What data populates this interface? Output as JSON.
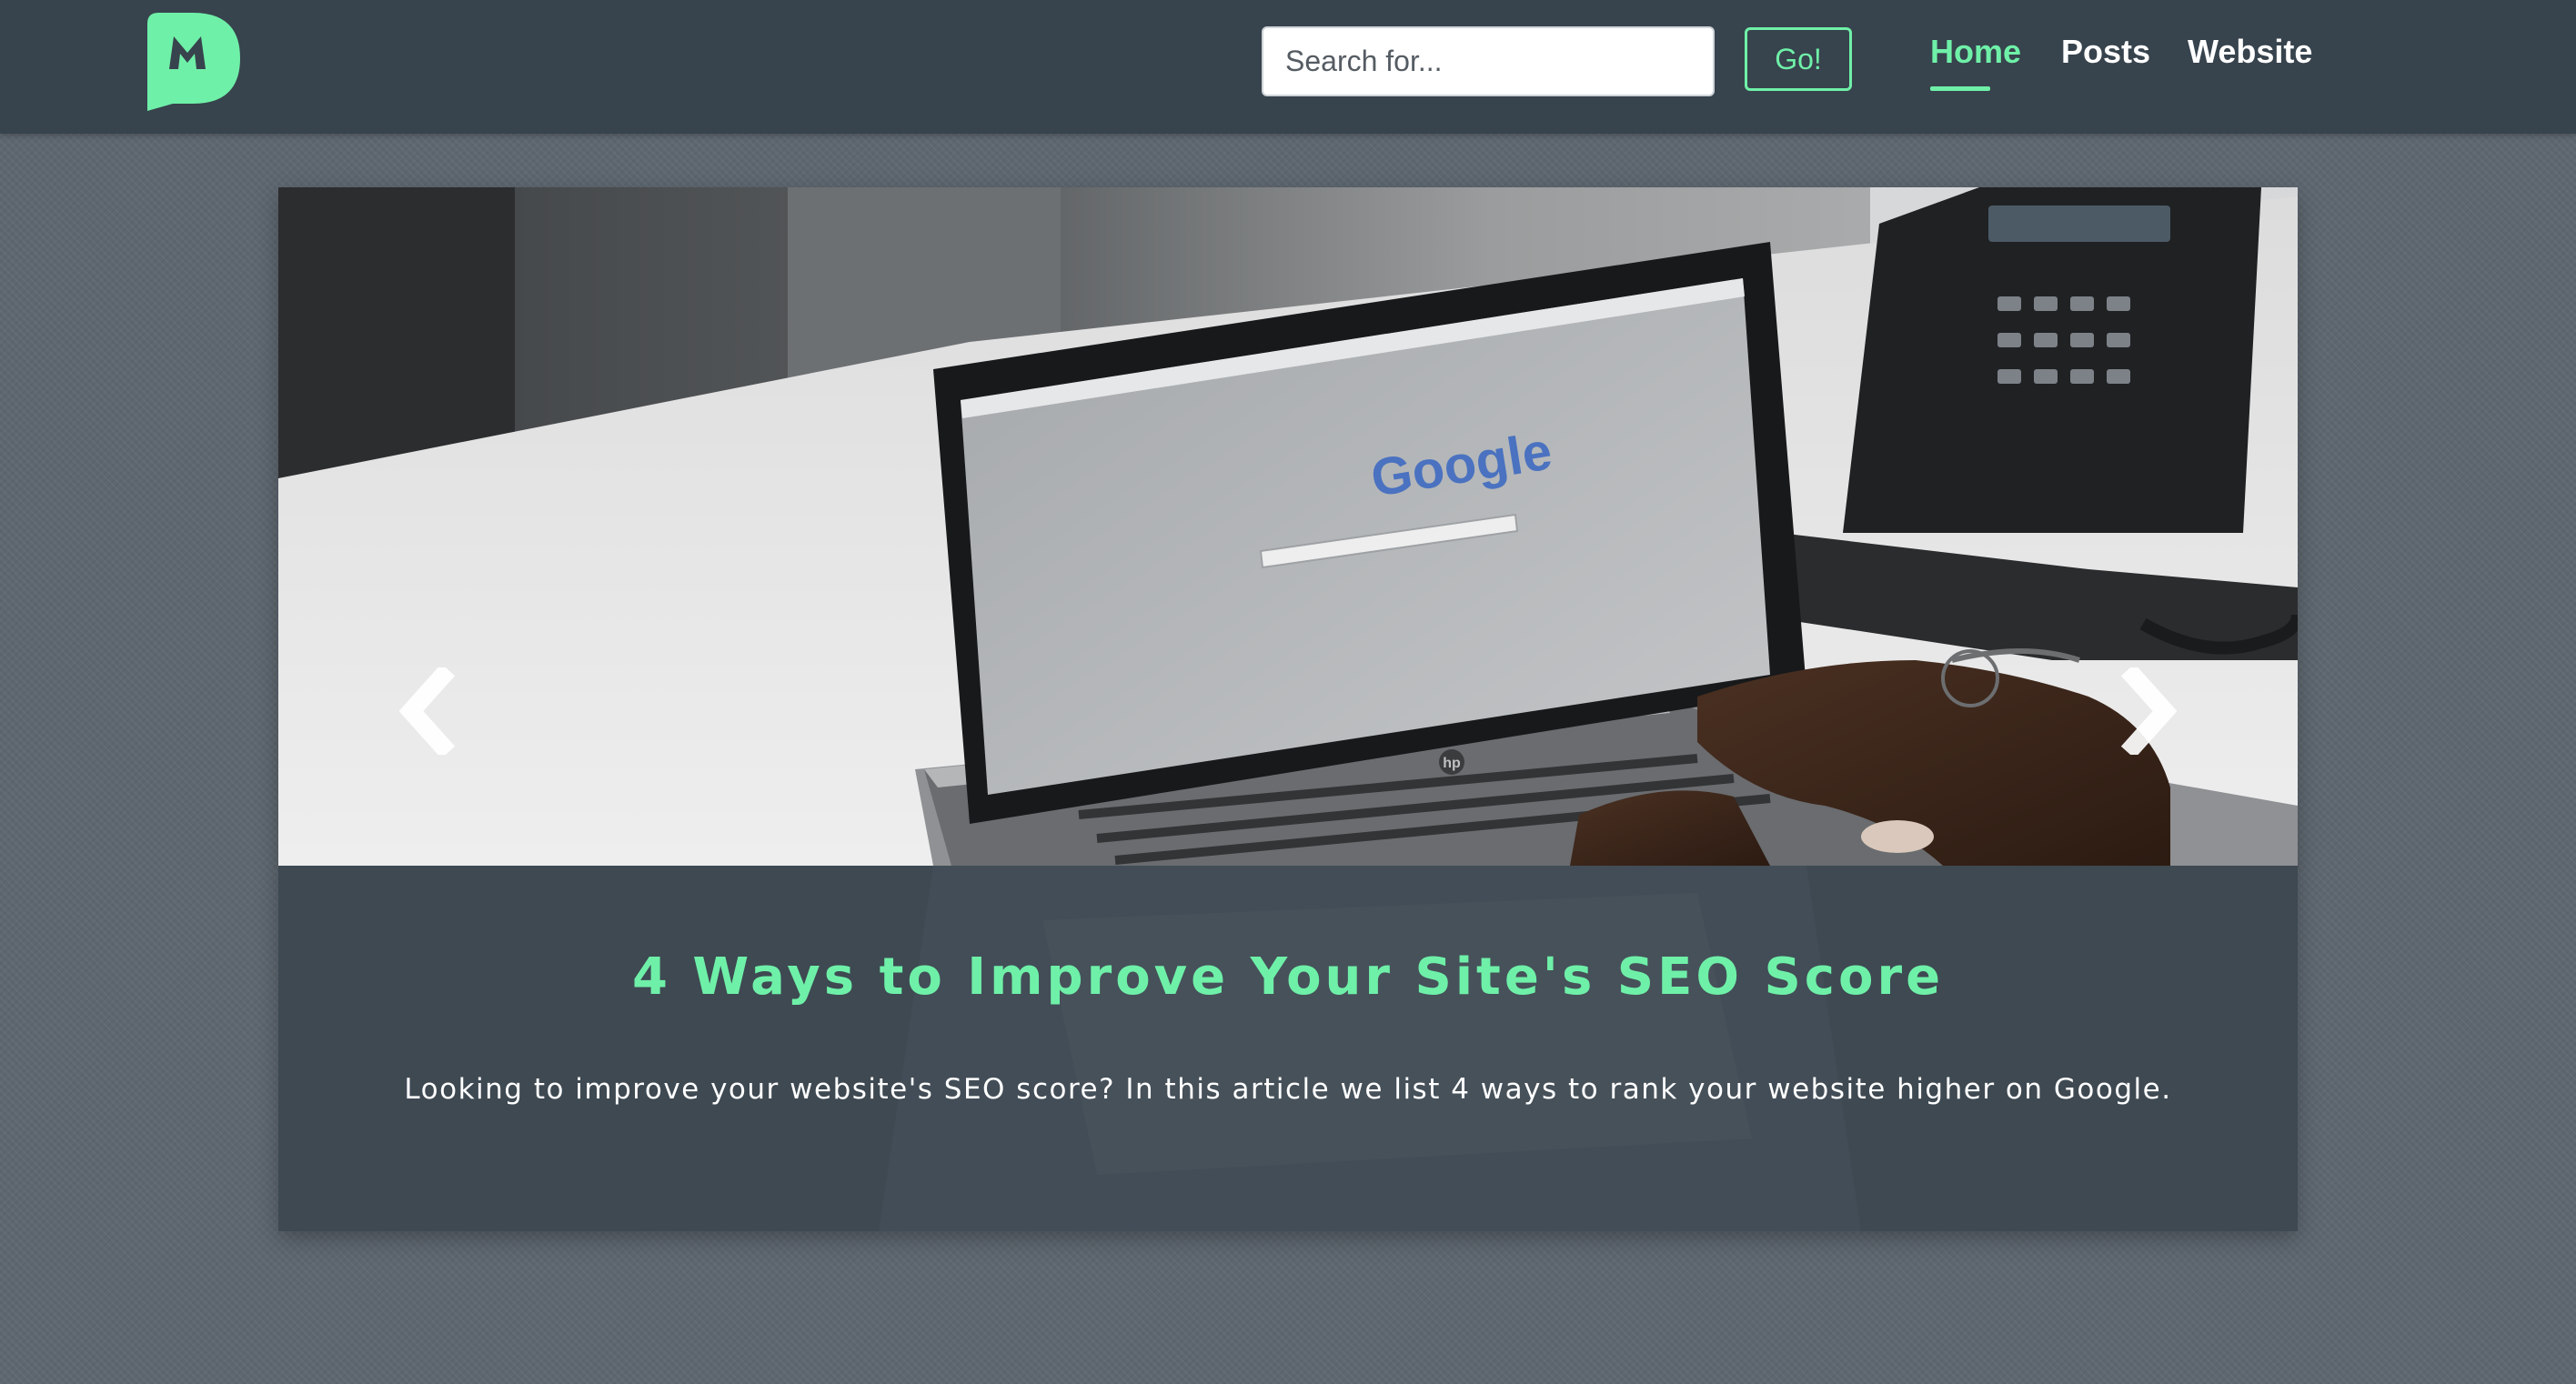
{
  "nav": {
    "search": {
      "placeholder": "Search for..."
    },
    "go_label": "Go!",
    "links": [
      {
        "label": "Home",
        "active": true
      },
      {
        "label": "Posts",
        "active": false
      },
      {
        "label": "Website",
        "active": false
      }
    ]
  },
  "carousel": {
    "image_screen_text": "Google",
    "laptop_brand": "hp",
    "slide": {
      "title": "4 Ways to Improve Your Site's SEO Score",
      "excerpt": "Looking to improve your website's SEO score? In this article we list 4 ways to rank your website higher on Google."
    }
  },
  "colors": {
    "accent": "#6ff0a8",
    "navbar": "#37434d",
    "background": "#5e6770",
    "caption": "#3e4952"
  }
}
